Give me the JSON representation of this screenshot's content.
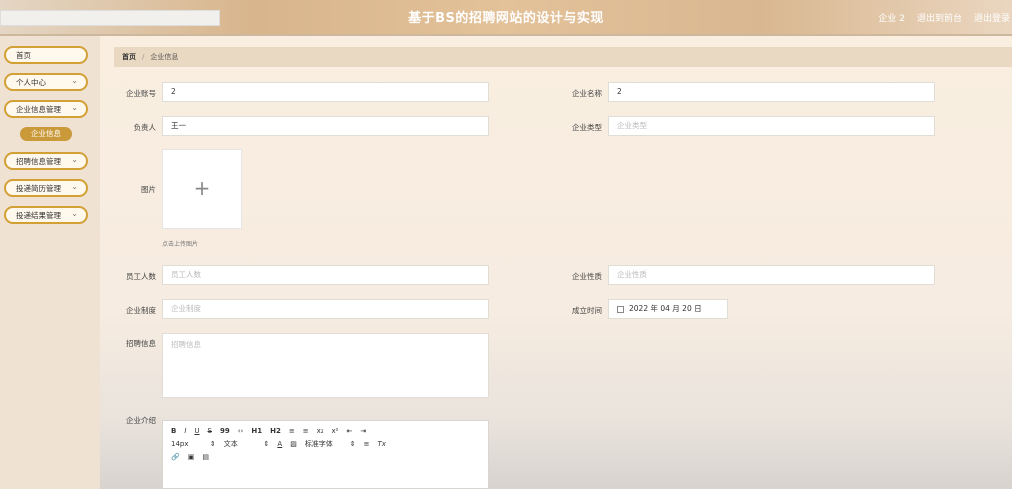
{
  "header": {
    "title": "基于BS的招聘网站的设计与实现",
    "user": "企业 2",
    "exit_admin": "退出到前台",
    "logout": "退出登录"
  },
  "sidebar": {
    "items": [
      {
        "label": "首页"
      },
      {
        "label": "个人中心"
      },
      {
        "label": "企业信息管理"
      },
      {
        "label": "招聘信息管理"
      },
      {
        "label": "投递简历管理"
      },
      {
        "label": "投递结果管理"
      }
    ],
    "active_sub": "企业信息"
  },
  "breadcrumb": {
    "home": "首页",
    "current": "企业信息"
  },
  "form": {
    "account_label": "企业账号",
    "account_value": "2",
    "name_label": "企业名称",
    "name_value": "2",
    "contact_label": "负责人",
    "contact_value": "王一",
    "type_label": "企业类型",
    "type_placeholder": "企业类型",
    "image_label": "图片",
    "upload_hint": "点击上传图片",
    "employees_label": "员工人数",
    "employees_placeholder": "员工人数",
    "nature_label": "企业性质",
    "nature_placeholder": "企业性质",
    "system_label": "企业制度",
    "system_placeholder": "企业制度",
    "founded_label": "成立时间",
    "founded_value": "2022 年 04 月 20 日",
    "recruit_label": "招聘信息",
    "recruit_placeholder": "招聘信息",
    "intro_label": "企业介绍"
  },
  "editor": {
    "row1": [
      "B",
      "I",
      "U",
      "S",
      "99",
      "‹›",
      "H1",
      "H2",
      "≡",
      "≡",
      "x₂",
      "x²",
      "⇤",
      "⇥"
    ],
    "font_size": "14px",
    "block": "文本",
    "font_family": "标准字体",
    "clear": "Tx"
  }
}
